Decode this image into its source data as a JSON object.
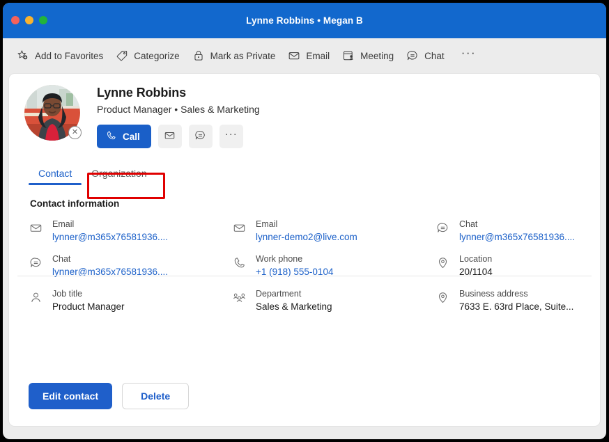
{
  "window": {
    "title": "Lynne Robbins • Megan B",
    "traffic_lights": [
      "close",
      "minimize",
      "maximize"
    ],
    "colors": {
      "titlebar": "#1268cd",
      "accent": "#1a5fc8",
      "highlight": "#e00000",
      "link": "#1a5fc8"
    }
  },
  "toolbar": {
    "items": [
      {
        "label": "Add to Favorites",
        "icon": "star-add-icon"
      },
      {
        "label": "Categorize",
        "icon": "tag-icon"
      },
      {
        "label": "Mark as Private",
        "icon": "lock-icon"
      },
      {
        "label": "Email",
        "icon": "envelope-icon"
      },
      {
        "label": "Meeting",
        "icon": "calendar-person-icon"
      },
      {
        "label": "Chat",
        "icon": "chat-bubble-icon"
      }
    ],
    "overflow_label": "···"
  },
  "contact": {
    "name": "Lynne Robbins",
    "subtitle": "Product Manager • Sales & Marketing",
    "avatar_remove_label": "✕",
    "actions": {
      "call_label": "Call",
      "email_icon": "envelope-icon",
      "chat_icon": "chat-bubble-icon",
      "more_label": "···"
    }
  },
  "tabs": [
    {
      "label": "Contact",
      "active": true
    },
    {
      "label": "Organization",
      "active": false
    }
  ],
  "section": {
    "title": "Contact information"
  },
  "fields": [
    {
      "label": "Email",
      "value": "lynner@m365x76581936....",
      "icon": "envelope-icon",
      "link": true,
      "col": 1
    },
    {
      "label": "Email",
      "value": "lynner-demo2@live.com",
      "icon": "envelope-icon",
      "link": true,
      "col": 2
    },
    {
      "label": "Chat",
      "value": "lynner@m365x76581936....",
      "icon": "chat-bubble-icon",
      "link": true,
      "col": 3
    },
    {
      "label": "Chat",
      "value": "lynner@m365x76581936....",
      "icon": "chat-bubble-icon",
      "link": true,
      "col": 1
    },
    {
      "label": "Work phone",
      "value": "+1 (918) 555-0104",
      "icon": "phone-icon",
      "link": true,
      "col": 2
    },
    {
      "label": "Location",
      "value": "20/1104",
      "icon": "location-pin-icon",
      "link": false,
      "col": 3
    },
    {
      "label": "Job title",
      "value": "Product Manager",
      "icon": "person-icon",
      "link": false,
      "col": 1
    },
    {
      "label": "Department",
      "value": "Sales & Marketing",
      "icon": "people-group-icon",
      "link": false,
      "col": 2
    },
    {
      "label": "Business address",
      "value": "7633 E. 63rd Place, Suite...",
      "icon": "location-pin-icon",
      "link": false,
      "col": 3
    }
  ],
  "footer": {
    "edit_label": "Edit contact",
    "delete_label": "Delete"
  }
}
